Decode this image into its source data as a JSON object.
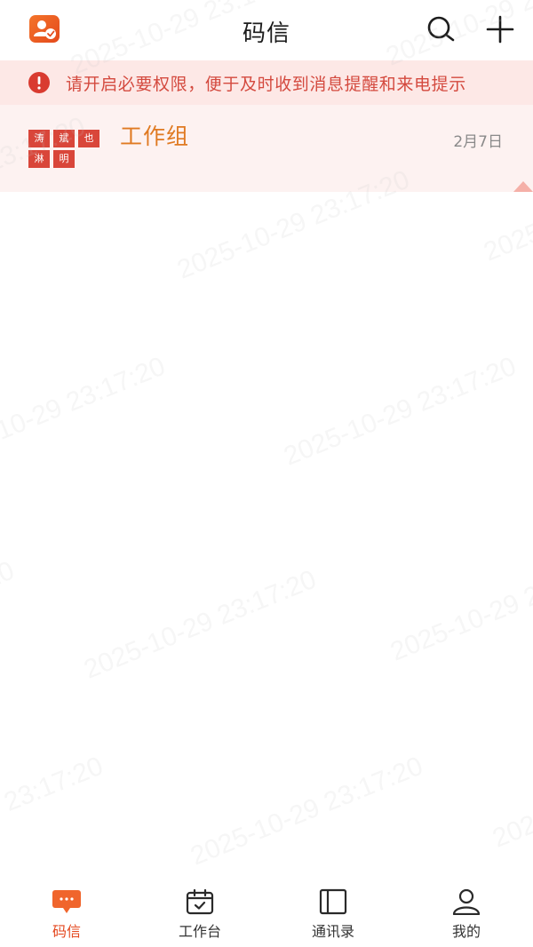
{
  "header": {
    "title": "码信",
    "logo_icon": "app-logo-icon",
    "search_icon": "search-icon",
    "add_icon": "plus-icon"
  },
  "banner": {
    "text": "请开启必要权限，便于及时收到消息提醒和来电提示",
    "icon": "alert-circle-icon",
    "color": "#d44a3f",
    "background": "#fde8e6"
  },
  "conversations": [
    {
      "name": "工作组",
      "date": "2月7日",
      "avatar_names": [
        "涛",
        "斌",
        "也",
        "淋",
        "明"
      ],
      "pinned": true
    }
  ],
  "nav": {
    "items": [
      {
        "label": "码信",
        "icon": "message-icon",
        "active": true
      },
      {
        "label": "工作台",
        "icon": "calendar-icon",
        "active": false
      },
      {
        "label": "通讯录",
        "icon": "contacts-book-icon",
        "active": false
      },
      {
        "label": "我的",
        "icon": "user-icon",
        "active": false
      }
    ]
  },
  "watermark": "2025-10-29 23:17:20",
  "colors": {
    "accent": "#e4471e",
    "group_name": "#e07a22",
    "avatar": "#d9463a",
    "row_highlight": "#fdf2f1"
  }
}
